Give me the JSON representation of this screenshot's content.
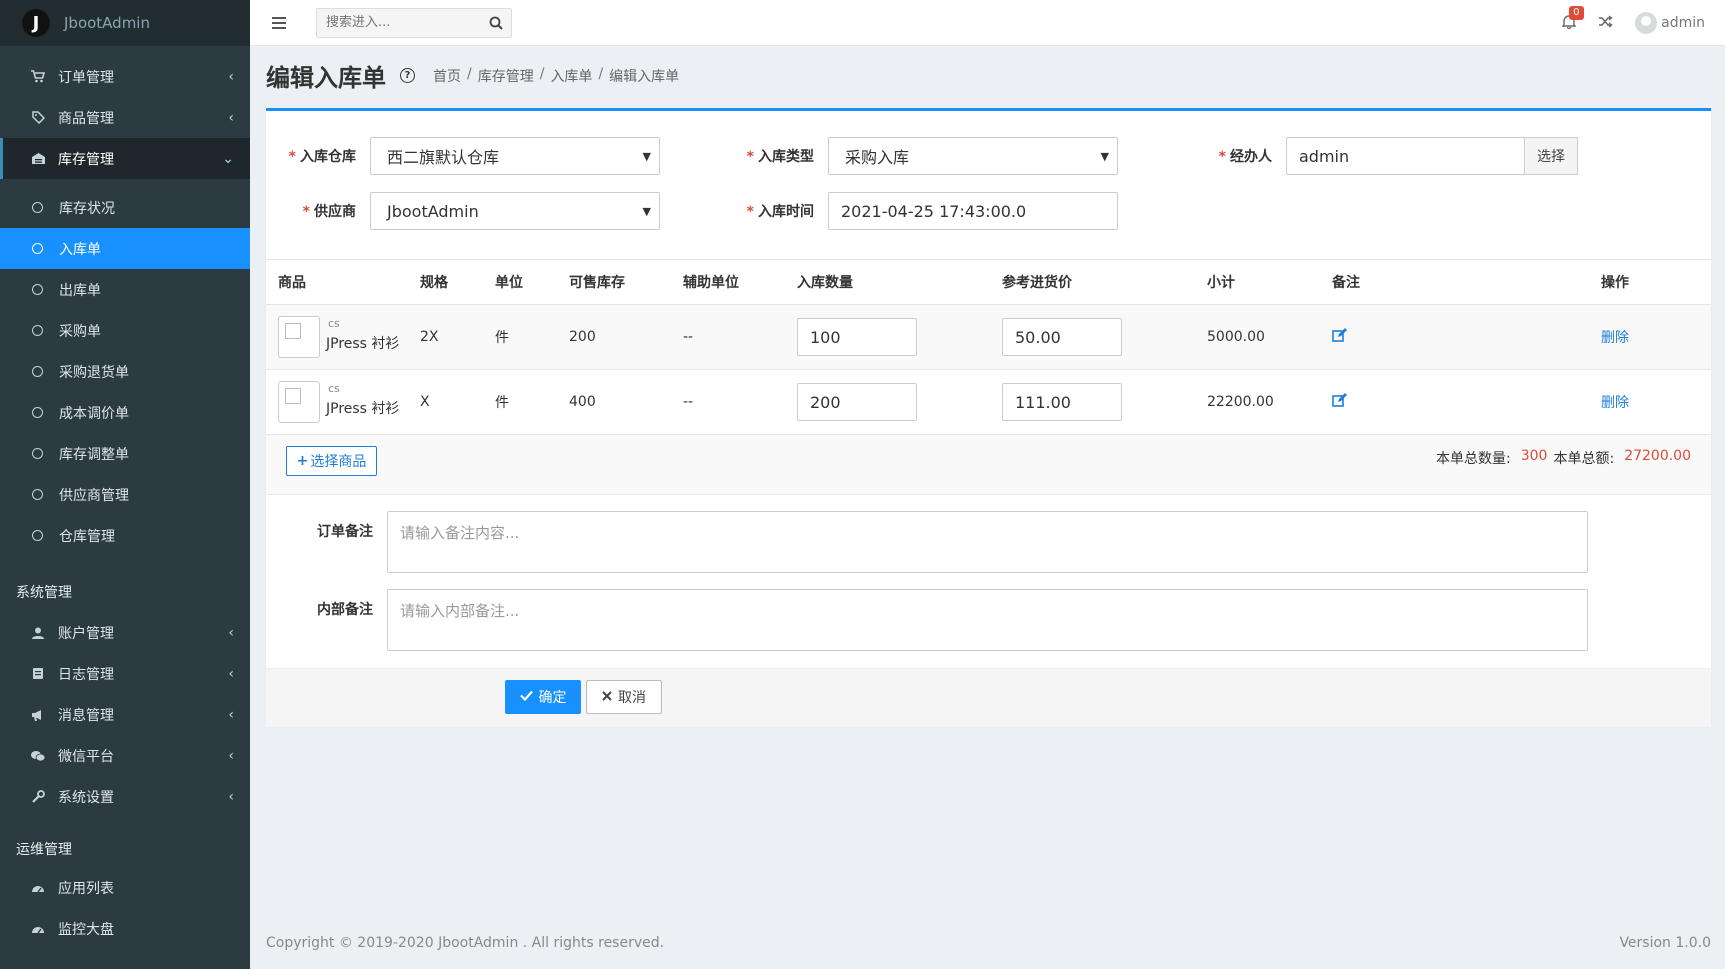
{
  "brand": {
    "logo": "J",
    "name": "JbootAdmin"
  },
  "sidebar": {
    "top_items": [
      {
        "label": "订单管理",
        "icon": "cart-icon"
      },
      {
        "label": "商品管理",
        "icon": "tag-icon"
      }
    ],
    "stock": {
      "label": "库存管理",
      "icon": "warehouse-icon",
      "subitems": [
        "库存状况",
        "入库单",
        "出库单",
        "采购单",
        "采购退货单",
        "成本调价单",
        "库存调整单",
        "供应商管理",
        "仓库管理"
      ]
    },
    "system_section": "系统管理",
    "system_items": [
      {
        "label": "账户管理",
        "icon": "user-icon"
      },
      {
        "label": "日志管理",
        "icon": "book-icon"
      },
      {
        "label": "消息管理",
        "icon": "bullhorn-icon"
      },
      {
        "label": "微信平台",
        "icon": "wechat-icon"
      },
      {
        "label": "系统设置",
        "icon": "wrench-icon"
      }
    ],
    "ops_section": "运维管理",
    "ops_items": [
      {
        "label": "应用列表",
        "icon": "dashboard-icon"
      },
      {
        "label": "监控大盘",
        "icon": "dashboard-icon"
      }
    ]
  },
  "topbar": {
    "search_placeholder": "搜索进入...",
    "notification_count": "0",
    "username": "admin"
  },
  "header": {
    "title": "编辑入库单",
    "breadcrumb": [
      "首页",
      "库存管理",
      "入库单",
      "编辑入库单"
    ]
  },
  "form": {
    "warehouse_label": "入库仓库",
    "warehouse_value": "西二旗默认仓库",
    "type_label": "入库类型",
    "type_value": "采购入库",
    "handler_label": "经办人",
    "handler_value": "admin",
    "choose_label": "选择",
    "supplier_label": "供应商",
    "supplier_value": "JbootAdmin",
    "time_label": "入库时间",
    "time_value": "2021-04-25 17:43:00.0"
  },
  "table": {
    "headers": [
      "商品",
      "规格",
      "单位",
      "可售库存",
      "辅助单位",
      "入库数量",
      "参考进货价",
      "小计",
      "备注",
      "操作"
    ],
    "rows": [
      {
        "code": "cs",
        "name": "JPress 衬衫",
        "spec": "2X",
        "unit": "件",
        "stock": "200",
        "aux": "--",
        "qty": "100",
        "price": "50.00",
        "subtotal": "5000.00",
        "action": "删除"
      },
      {
        "code": "cs",
        "name": "JPress 衬衫",
        "spec": "X",
        "unit": "件",
        "stock": "400",
        "aux": "--",
        "qty": "200",
        "price": "111.00",
        "subtotal": "22200.00",
        "action": "删除"
      }
    ],
    "select_goods_label": "选择商品",
    "total_qty_label": "本单总数量:",
    "total_qty": "300",
    "total_amount_label": "本单总额:",
    "total_amount": "27200.00"
  },
  "remarks": {
    "order_label": "订单备注",
    "order_placeholder": "请输入备注内容...",
    "internal_label": "内部备注",
    "internal_placeholder": "请输入内部备注..."
  },
  "buttons": {
    "ok": "确定",
    "cancel": "取消"
  },
  "footer": {
    "copyright": "Copyright © 2019-2020 JbootAdmin . All rights reserved.",
    "version": "Version 1.0.0"
  },
  "colors": {
    "primary": "#1890ff",
    "sidebar": "#2c3b41",
    "danger": "#dd4b39"
  }
}
